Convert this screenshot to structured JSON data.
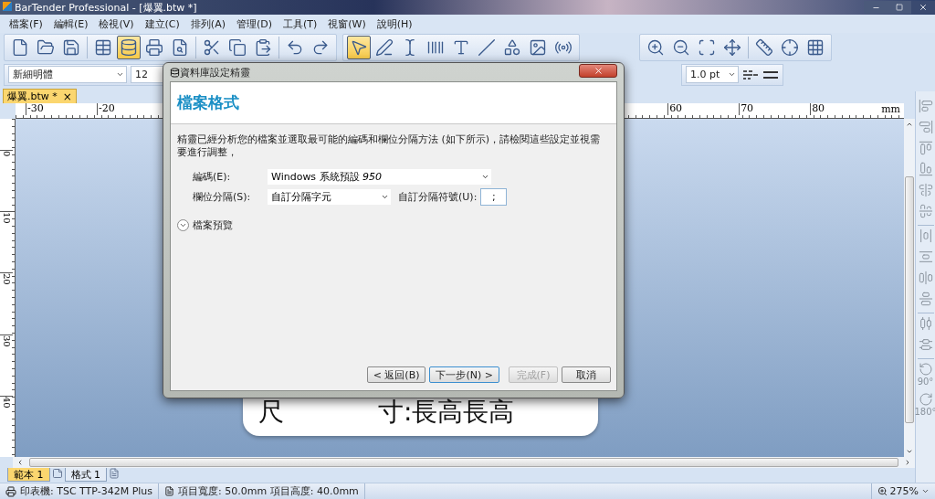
{
  "window": {
    "title": "BarTender Professional - [爆翼.btw *]"
  },
  "menu": [
    "檔案(F)",
    "編輯(E)",
    "檢視(V)",
    "建立(C)",
    "排列(A)",
    "管理(D)",
    "工具(T)",
    "視窗(W)",
    "說明(H)"
  ],
  "toolbar_groups": [
    [
      {
        "kind": "new",
        "selected": false
      },
      {
        "kind": "open",
        "selected": false
      },
      {
        "kind": "save",
        "selected": false
      },
      {
        "kind": "sep"
      },
      {
        "kind": "table",
        "selected": false
      },
      {
        "kind": "database",
        "selected": true
      },
      {
        "kind": "print",
        "selected": false
      },
      {
        "kind": "preview",
        "selected": false
      },
      {
        "kind": "sep"
      },
      {
        "kind": "cut",
        "selected": false
      },
      {
        "kind": "copy",
        "selected": false
      },
      {
        "kind": "paste",
        "selected": false
      },
      {
        "kind": "sep"
      },
      {
        "kind": "undo",
        "selected": false
      },
      {
        "kind": "redo",
        "selected": false
      }
    ],
    [
      {
        "kind": "pointer",
        "selected": true
      },
      {
        "kind": "pen",
        "selected": false
      },
      {
        "kind": "text",
        "selected": false
      },
      {
        "kind": "barcode",
        "selected": false
      },
      {
        "kind": "letter",
        "selected": false
      },
      {
        "kind": "line",
        "selected": false
      },
      {
        "kind": "shape",
        "selected": false
      },
      {
        "kind": "image",
        "selected": false
      },
      {
        "kind": "rfid",
        "selected": false
      }
    ],
    [
      {
        "kind": "zoomin",
        "selected": false
      },
      {
        "kind": "zoomout",
        "selected": false
      },
      {
        "kind": "zoomarea",
        "selected": false
      },
      {
        "kind": "fit",
        "selected": false
      },
      {
        "kind": "sep"
      },
      {
        "kind": "ruler",
        "selected": false
      },
      {
        "kind": "snap",
        "selected": false
      },
      {
        "kind": "grid",
        "selected": false
      }
    ]
  ],
  "format_bar": {
    "font": "新細明體",
    "size": "12",
    "line_weight": "1.0 pt"
  },
  "document_tab": {
    "label": "爆翼.btw *",
    "close": "×"
  },
  "top_ruler": {
    "left_labels": [
      "-30",
      "-20"
    ],
    "right_labels": [
      "60",
      "70",
      "80"
    ],
    "unit": "mm"
  },
  "left_ruler": {
    "labels": [
      "0",
      "10",
      "20",
      "30",
      "40"
    ]
  },
  "label_card": {
    "texts": [
      "尺",
      "寸:長高長高"
    ]
  },
  "sheet_tabs": [
    {
      "label": "範本 1",
      "selected": true
    },
    {
      "label": "格式 1",
      "selected": false
    }
  ],
  "align_toolbar": [
    {
      "kind": "left"
    },
    {
      "kind": "right"
    },
    {
      "kind": "top"
    },
    {
      "kind": "bottom"
    },
    {
      "kind": "hcenter"
    },
    {
      "kind": "vcenter"
    },
    {
      "kind": "sep"
    },
    {
      "kind": "spaceh"
    },
    {
      "kind": "spacev"
    },
    {
      "kind": "centerh"
    },
    {
      "kind": "centerv"
    },
    {
      "kind": "sep"
    },
    {
      "kind": "disth"
    },
    {
      "kind": "distv"
    },
    {
      "kind": "sep"
    },
    {
      "kind": "rotl",
      "caption": "90°"
    },
    {
      "kind": "rotr",
      "caption": "180°"
    }
  ],
  "status_bar": {
    "printer": "印表機: TSC TTP-342M Plus",
    "size": "項目寬度: 50.0mm  項目高度: 40.0mm",
    "zoom": "275%"
  },
  "dialog": {
    "title": "資料庫設定精靈",
    "heading": "檔案格式",
    "description": "精靈已經分析您的檔案並選取最可能的編碼和欄位分隔方法 (如下所示)，請檢閱這些設定並視需要進行調整，",
    "encoding_label": "編碼(E):",
    "encoding_value": "Windows 系統預設  *950*",
    "separator_label": "欄位分隔(S):",
    "separator_value": "自訂分隔字元",
    "custom_label": "自訂分隔符號(U):",
    "custom_value": ";",
    "preview": {
      "label": "檔案預覽",
      "expanded": false
    },
    "buttons": [
      {
        "label": "< 返回(B)",
        "disabled": false,
        "default": false
      },
      {
        "label": "下一步(N) >",
        "disabled": false,
        "default": true
      },
      {
        "label": "完成(F)",
        "disabled": true,
        "default": false
      },
      {
        "label": "取消",
        "disabled": false,
        "default": false
      }
    ]
  }
}
